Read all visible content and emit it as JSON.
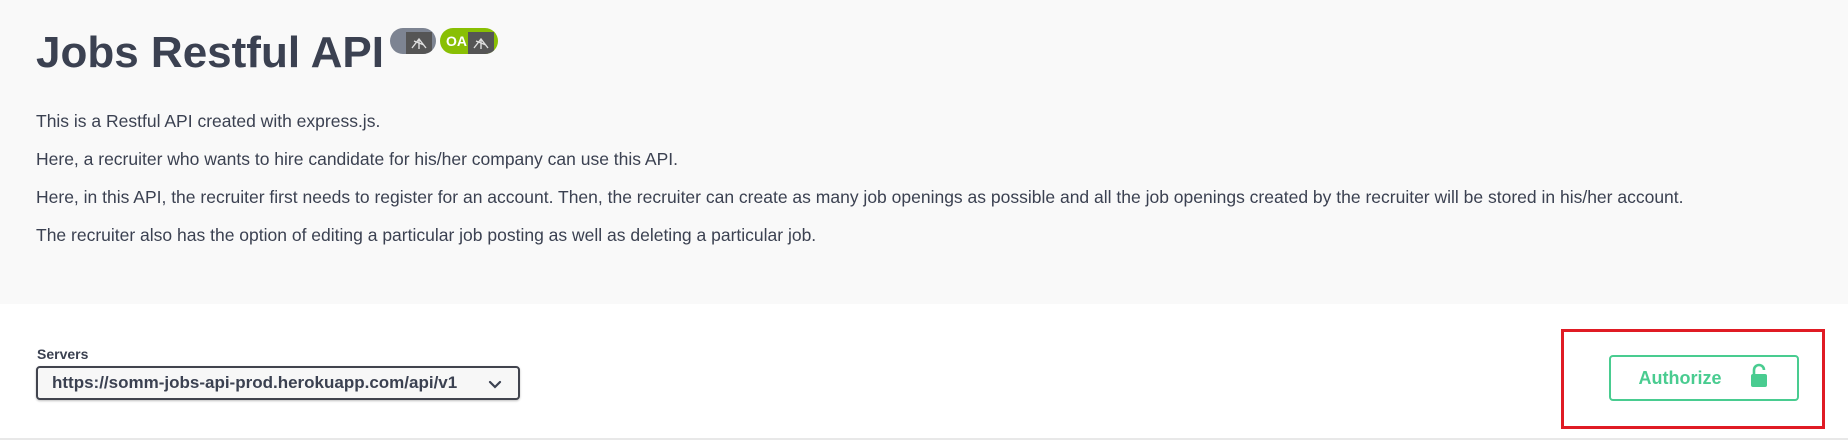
{
  "info": {
    "title": "Jobs Restful API",
    "badges": [
      {
        "kind": "version",
        "icon": "version-badge-icon"
      },
      {
        "kind": "oas",
        "text": "OA",
        "icon": "oas-badge-icon"
      }
    ],
    "description": [
      "This is a Restful API created with express.js.",
      "Here, a recruiter who wants to hire candidate for his/her company can use this API.",
      "Here, in this API, the recruiter first needs to register for an account. Then, the recruiter can create as many job openings as possible and all the job openings created by the recruiter will be stored in his/her account.",
      "The recruiter also has the option of editing a particular job posting as well as deleting a particular job."
    ]
  },
  "servers": {
    "label": "Servers",
    "selected": "https://somm-jobs-api-prod.herokuapp.com/api/v1"
  },
  "authorize": {
    "label": "Authorize",
    "icon": "unlock-icon"
  },
  "colors": {
    "accent": "#49cc90",
    "highlight": "#e01b24",
    "text": "#3b4151",
    "info_bg": "#f9f9f9"
  }
}
